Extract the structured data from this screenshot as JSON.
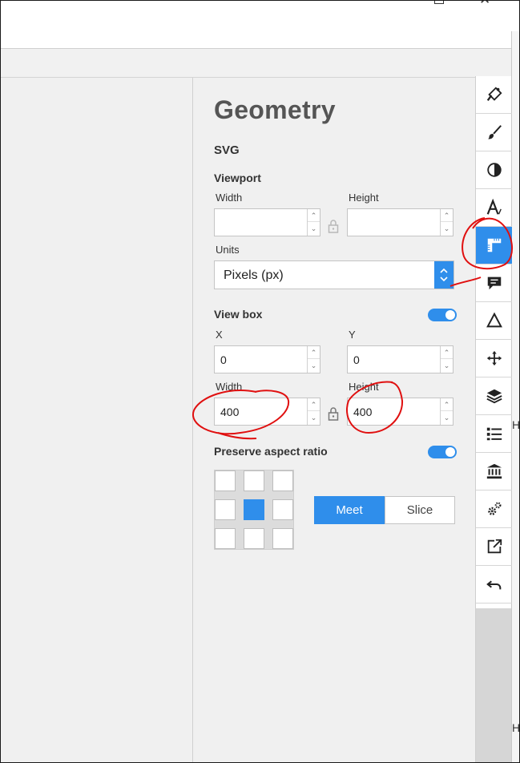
{
  "window": {
    "maximize_icon": "maximize-icon",
    "close_icon": "close-icon",
    "close_glyph": "✕"
  },
  "edge": {
    "h1": "H",
    "h2": "H"
  },
  "panel": {
    "title": "Geometry",
    "section": "SVG",
    "viewport": {
      "label": "Viewport",
      "width_label": "Width",
      "height_label": "Height",
      "width_value": "",
      "height_value": "",
      "units_label": "Units",
      "units_value": "Pixels (px)"
    },
    "viewbox": {
      "label": "View box",
      "enabled": true,
      "x_label": "X",
      "y_label": "Y",
      "x_value": "0",
      "y_value": "0",
      "width_label": "Width",
      "height_label": "Height",
      "width_value": "400",
      "height_value": "400"
    },
    "aspect": {
      "label": "Preserve aspect ratio",
      "enabled": true,
      "alignment_selected": "center",
      "meet_label": "Meet",
      "slice_label": "Slice",
      "mode_selected": "Meet"
    }
  },
  "sidebar": {
    "active": "geometry",
    "icons": [
      "paint-bucket-icon",
      "brush-icon",
      "contrast-icon",
      "text-style-icon",
      "geometry-ruler-icon",
      "comment-icon",
      "triangle-icon",
      "move-icon",
      "layers-icon",
      "list-icon",
      "bank-icon",
      "settings-gears-icon",
      "export-icon",
      "undo-icon"
    ]
  },
  "colors": {
    "accent": "#2f8eeb",
    "panel_bg": "#f0f0f0",
    "annotation": "#e01010"
  }
}
